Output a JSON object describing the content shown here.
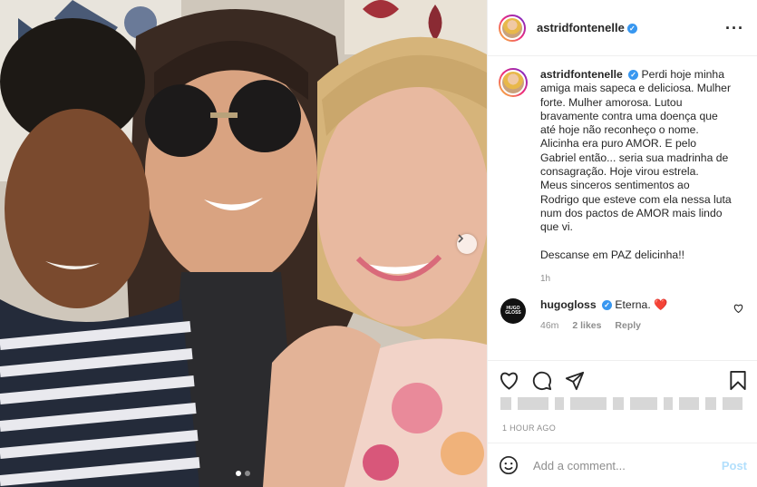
{
  "post": {
    "username": "astridfontenelle",
    "caption_lines": [
      "Perdi hoje minha",
      "amiga mais sapeca e deliciosa. Mulher",
      "forte. Mulher amorosa. Lutou",
      "bravamente contra uma doença que",
      "até hoje não reconheço o nome.",
      "Alicinha era puro AMOR. E pelo",
      "Gabriel então... seria sua madrinha de",
      "consagração. Hoje virou estrela.",
      "Meus sinceros sentimentos ao",
      "Rodrigo que esteve com ela nessa luta",
      "num dos pactos de AMOR mais lindo",
      "que vi.",
      "",
      "Descanse em PAZ delicinha!!"
    ],
    "caption_time": "1h",
    "timestamp": "1 HOUR AGO"
  },
  "comment": {
    "username": "hugogloss",
    "avatar_text": "HUGO GLOSS",
    "text": "Eterna.",
    "emoji": "❤️",
    "time": "46m",
    "likes": "2 likes",
    "reply_label": "Reply"
  },
  "add_comment": {
    "placeholder": "Add a comment...",
    "post_label": "Post"
  },
  "carousel": {
    "total": 2,
    "current": 1
  },
  "icons": {
    "more": "more-options-icon",
    "like": "heart-icon",
    "comment": "comment-icon",
    "share": "paper-plane-icon",
    "save": "bookmark-icon",
    "emoji": "smiley-icon",
    "next": "chevron-right-icon"
  },
  "colors": {
    "verified": "#3897f0",
    "heart": "#ed4956",
    "post_disabled": "#b2dffc"
  }
}
